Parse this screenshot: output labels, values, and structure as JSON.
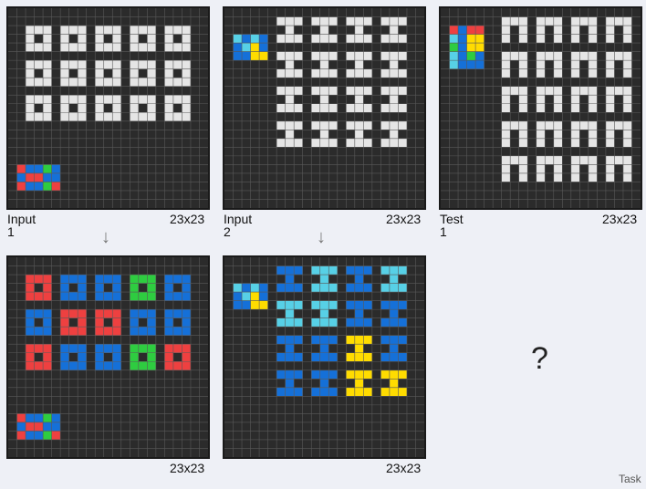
{
  "colors": {
    "bg": "#2b2b2b",
    "grid": "#5a5a5a",
    "white": "#e5e5e5",
    "red": "#ee4040",
    "blue": "#1570d8",
    "green": "#2ecc40",
    "cyan": "#57d0e6",
    "yellow": "#ffdc00"
  },
  "grid_size": 23,
  "labels": {
    "input1": "Input 1",
    "input1_size": "23x23",
    "input2": "Input 2",
    "input2_size": "23x23",
    "test1": "Test 1",
    "test1_size": "23x23",
    "output1_size": "23x23",
    "output2_size": "23x23",
    "question": "?",
    "task": "Task"
  },
  "boards": {
    "input1": {
      "shapes": [
        {
          "type": "ring",
          "rows": [
            2,
            6,
            10
          ],
          "cols": [
            2,
            6,
            10,
            14,
            18
          ],
          "colors": [
            "white",
            "white",
            "white",
            "white",
            "white",
            "white",
            "white",
            "white",
            "white",
            "white",
            "white",
            "white",
            "white",
            "white",
            "white"
          ]
        }
      ],
      "pattern": {
        "row": 18,
        "col": 1,
        "cells": [
          [
            "red",
            "blue",
            "blue",
            "green",
            "blue"
          ],
          [
            "blue",
            "red",
            "red",
            "blue",
            "blue"
          ],
          [
            "red",
            "blue",
            "blue",
            "green",
            "red"
          ]
        ]
      }
    },
    "output1": {
      "shapes": [
        {
          "type": "ring",
          "rows": [
            2,
            6,
            10
          ],
          "cols": [
            2,
            6,
            10,
            14,
            18
          ],
          "colors": [
            "red",
            "blue",
            "blue",
            "green",
            "blue",
            "blue",
            "red",
            "red",
            "blue",
            "blue",
            "red",
            "blue",
            "blue",
            "green",
            "red"
          ]
        }
      ],
      "pattern": {
        "row": 18,
        "col": 1,
        "cells": [
          [
            "red",
            "blue",
            "blue",
            "green",
            "blue"
          ],
          [
            "blue",
            "red",
            "red",
            "blue",
            "blue"
          ],
          [
            "red",
            "blue",
            "blue",
            "green",
            "red"
          ]
        ]
      }
    },
    "input2": {
      "shapes": [
        {
          "type": "ibeam",
          "rows": [
            1,
            5,
            9,
            13
          ],
          "cols": [
            6,
            10,
            14,
            18
          ],
          "colors": [
            "white",
            "white",
            "white",
            "white",
            "white",
            "white",
            "white",
            "white",
            "white",
            "white",
            "white",
            "white",
            "white",
            "white",
            "white",
            "white"
          ]
        }
      ],
      "pattern": {
        "row": 3,
        "col": 1,
        "cells": [
          [
            "cyan",
            "blue",
            "cyan",
            "blue"
          ],
          [
            "blue",
            "cyan",
            "yellow",
            "blue"
          ],
          [
            "blue",
            "blue",
            "yellow",
            "yellow"
          ]
        ]
      }
    },
    "output2": {
      "shapes": [
        {
          "type": "ibeam",
          "rows": [
            1,
            5,
            9,
            13
          ],
          "cols": [
            6,
            10,
            14,
            18
          ],
          "colors": [
            "blue",
            "cyan",
            "blue",
            "cyan",
            "cyan",
            "cyan",
            "blue",
            "blue",
            "blue",
            "blue",
            "yellow",
            "blue",
            "blue",
            "blue",
            "yellow",
            "yellow"
          ]
        }
      ],
      "pattern": {
        "row": 3,
        "col": 1,
        "cells": [
          [
            "cyan",
            "blue",
            "cyan",
            "blue"
          ],
          [
            "blue",
            "cyan",
            "yellow",
            "blue"
          ],
          [
            "blue",
            "blue",
            "yellow",
            "yellow"
          ]
        ]
      }
    },
    "test1": {
      "shapes": [
        {
          "type": "arch",
          "rows": [
            1,
            5,
            9,
            13,
            17
          ],
          "cols": [
            7,
            11,
            15,
            19
          ],
          "colors": [
            "white",
            "white",
            "white",
            "white",
            "white",
            "white",
            "white",
            "white",
            "white",
            "white",
            "white",
            "white",
            "white",
            "white",
            "white",
            "white",
            "white",
            "white",
            "white",
            "white"
          ]
        }
      ],
      "pattern": {
        "row": 2,
        "col": 1,
        "cells": [
          [
            "red",
            "blue",
            "red",
            "red"
          ],
          [
            "cyan",
            "blue",
            "yellow",
            "yellow"
          ],
          [
            "green",
            "blue",
            "yellow",
            "yellow"
          ],
          [
            "cyan",
            "blue",
            "green",
            "blue"
          ],
          [
            "cyan",
            "blue",
            "blue",
            "blue"
          ]
        ]
      }
    }
  }
}
